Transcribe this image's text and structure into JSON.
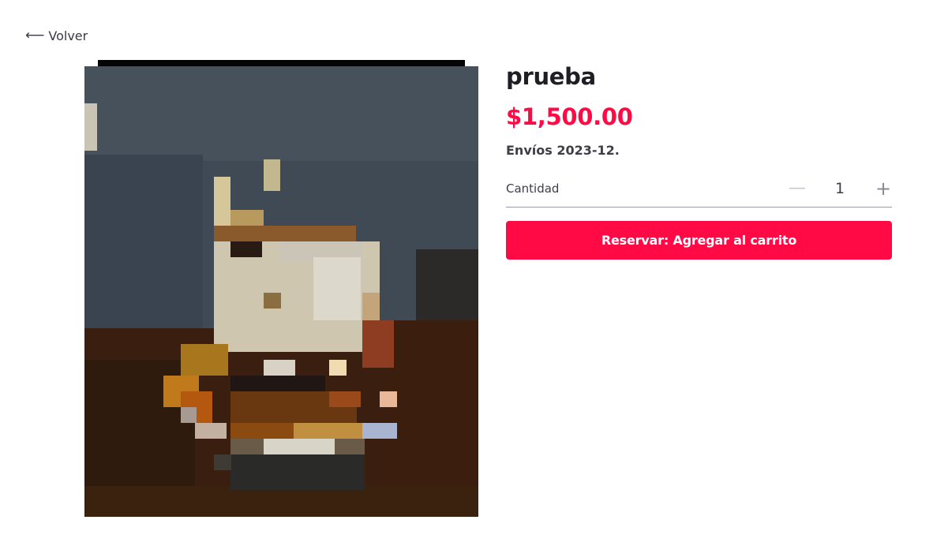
{
  "nav": {
    "back_icon": "arrow-left-icon",
    "back_label": "Volver"
  },
  "product": {
    "image_alt": "",
    "title": "prueba",
    "price": "$1,500.00",
    "shipping": "Envíos 2023-12."
  },
  "quantity": {
    "label": "Cantidad",
    "minus_label": "—",
    "value": "1",
    "plus_label": "+"
  },
  "actions": {
    "add_to_cart_label": "Reservar: Agregar al carrito"
  },
  "colors": {
    "accent": "#ff0a45",
    "text_dark": "#1e1e24",
    "text_muted": "#3e3e48"
  }
}
